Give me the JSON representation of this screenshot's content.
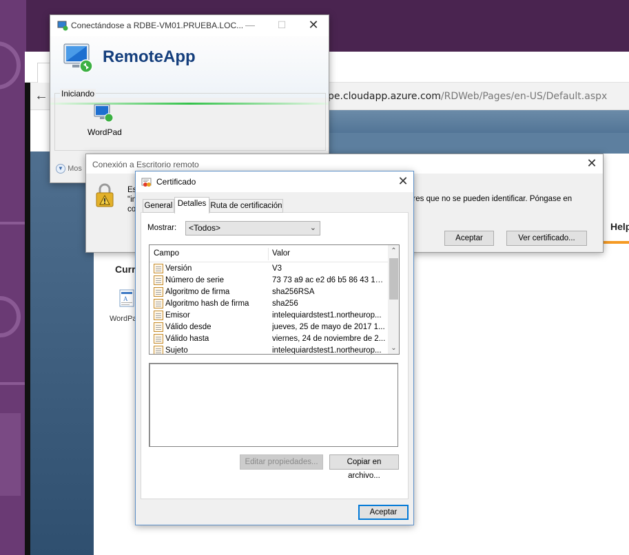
{
  "browser": {
    "url_host": "pe.cloudapp.azure.com",
    "url_path": "/RDWeb/Pages/en-US/Default.aspx",
    "help_label": "Help",
    "current_label": "Curr",
    "app_label": "WordPa"
  },
  "remoteapp": {
    "window_title": "Conectándose a RDBE-VM01.PRUEBA.LOC...",
    "heading": "RemoteApp",
    "group_label": "Iniciando",
    "app_name": "WordPad",
    "more_label": "Mos"
  },
  "conexion": {
    "window_title": "Conexión a Escritorio remoto",
    "text_line1": "Es",
    "text_line2": "\"in",
    "text_line3": "co",
    "text_right0": "o",
    "text_right": "ores que no se pueden identificar. Póngase en",
    "accept_label": "Aceptar",
    "view_cert_label": "Ver certificado..."
  },
  "cert": {
    "window_title": "Certificado",
    "tabs": [
      "General",
      "Detalles",
      "Ruta de certificación"
    ],
    "active_tab": "Detalles",
    "show_label": "Mostrar:",
    "show_value": "<Todos>",
    "col_field": "Campo",
    "col_value": "Valor",
    "rows": [
      {
        "field": "Versión",
        "value": "V3"
      },
      {
        "field": "Número de serie",
        "value": "73 73 a9 ac e2 d6 b5 86 43 1d..."
      },
      {
        "field": "Algoritmo de firma",
        "value": "sha256RSA"
      },
      {
        "field": "Algoritmo hash de firma",
        "value": "sha256"
      },
      {
        "field": "Emisor",
        "value": "intelequiardstest1.northeurop..."
      },
      {
        "field": "Válido desde",
        "value": "jueves, 25 de mayo de 2017 1..."
      },
      {
        "field": "Válido hasta",
        "value": "viernes, 24 de noviembre de 2..."
      },
      {
        "field": "Sujeto",
        "value": "intelequiardstest1.northeurop..."
      }
    ],
    "edit_props_label": "Editar propiedades...",
    "copy_file_label": "Copiar en archivo...",
    "accept_label": "Aceptar"
  },
  "colors": {
    "desktop": "#4a2450",
    "remoteapp_heading": "#143e7c",
    "accent_blue": "#0078d7"
  }
}
